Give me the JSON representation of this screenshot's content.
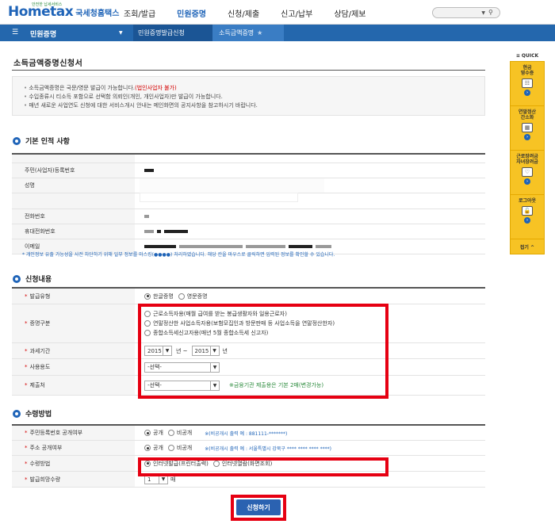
{
  "header": {
    "brand": "Hometax",
    "brand_kr": "국세청홈택스",
    "tagline": "안전한 납세서비스",
    "gnb": [
      "조회/발급",
      "민원증명",
      "신청/제출",
      "신고/납부",
      "상담/제보"
    ],
    "active_gnb": "민원증명"
  },
  "navbar": {
    "menu_label": "민원증명",
    "crumb1": "민원증명발급신청",
    "crumb2": "소득금액증명"
  },
  "page": {
    "title": "소득금액증명신청서",
    "notices": [
      {
        "text": "소득금액증명은 국문/영문 발급이 가능합니다.",
        "red": "(법인사업자 불가)"
      },
      {
        "text": "수입종류시 티소득 포함으로 선택함 의뢰인(개인, 개인사업자)만 발급이 가능합니다.",
        "red": ""
      },
      {
        "text": "매년 새로운 사업연도 신청에 대한 서비스개시 안내는 메인화면의 공지사항을 참고하시기 바랍니다.",
        "red": ""
      }
    ]
  },
  "sections": {
    "basic": "기본 인적 사항",
    "apply": "신청내용",
    "receive": "수령방법"
  },
  "basic": {
    "labels": [
      "주민(사업자)등록번호",
      "성명",
      "전화번호",
      "휴대전화번호",
      "이메일"
    ],
    "masking_note": "* 개인정보 유출 가능성을 사전 차단하기 위해 일부 정보를 마스킹(●●●●) 처리하였습니다. 해당 칸을 마우스로 클릭하면 입력된 정보를 확인할 수 있습니다."
  },
  "apply": {
    "issue_type_label": "발급유형",
    "issue_options": [
      "한글증명",
      "영문증명"
    ],
    "cert_type_label": "증명구분",
    "cert_options": [
      "근로소득자용(매월 급여를 받는 봉급생활자와 일용근로자)",
      "연말정산한 사업소득자용(보험모집인과 방문판매 등 사업소득을 연말정산한자)",
      "종합소득세신고자용(매년 5월 종합소득세 신고자)"
    ],
    "period_label": "과세기간",
    "period_from": "2015",
    "period_from_unit": "년 ~",
    "period_to": "2015",
    "period_to_unit": "년",
    "usage_label": "사용용도",
    "usage_value": "-선택-",
    "submit_to_label": "제출처",
    "submit_to_value": "-선택-",
    "submit_to_hint": "※금융기관 제출용은 기본 2매(변경가능)"
  },
  "receive": {
    "rrn_label": "주민등록번호 공개여부",
    "rrn_options": [
      "공개",
      "비공개"
    ],
    "rrn_hint": "※(비공개시 출력 예 : 881111-*******)",
    "addr_label": "주소 공개여부",
    "addr_options": [
      "공개",
      "비공개"
    ],
    "addr_hint": "※(비공개시 출력 예 : 서울특별시 강북구 **** **** **** ****)",
    "method_label": "수령방법",
    "method_options": [
      "인터넷발급(프린터출력)",
      "인터넷열람(화면조회)"
    ],
    "count_label": "발급희망수량",
    "count_value": "1",
    "count_unit": "매"
  },
  "submit_label": "신청하기",
  "quick": {
    "title": "≡ QUICK",
    "items": [
      {
        "label": "현금\n영수증",
        "icon": "receipt-icon"
      },
      {
        "label": "연말정산\n간소화",
        "icon": "calculator-icon"
      },
      {
        "label": "근로장려금\n자녀장려금",
        "icon": "heart-icon"
      },
      {
        "label": "로그아웃",
        "icon": "lock-icon"
      }
    ],
    "close": "접기 ^"
  }
}
